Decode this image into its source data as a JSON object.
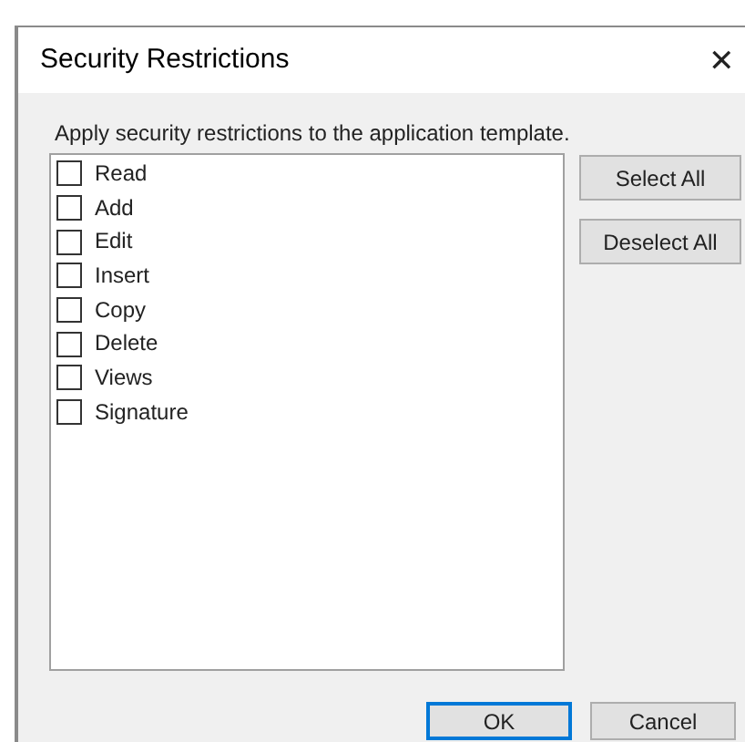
{
  "window": {
    "title": "Security Restrictions",
    "close": "✕"
  },
  "description": "Apply security restrictions to the application template.",
  "items": [
    {
      "label": "Read",
      "checked": false
    },
    {
      "label": "Add",
      "checked": false
    },
    {
      "label": "Edit",
      "checked": false
    },
    {
      "label": "Insert",
      "checked": false
    },
    {
      "label": "Copy",
      "checked": false
    },
    {
      "label": "Delete",
      "checked": false
    },
    {
      "label": "Views",
      "checked": false
    },
    {
      "label": "Signature",
      "checked": false
    }
  ],
  "side_buttons": [
    "Select All",
    "Deselect All"
  ],
  "buttons": [
    {
      "label": "OK",
      "default": true
    },
    {
      "label": "Cancel",
      "default": false
    }
  ]
}
